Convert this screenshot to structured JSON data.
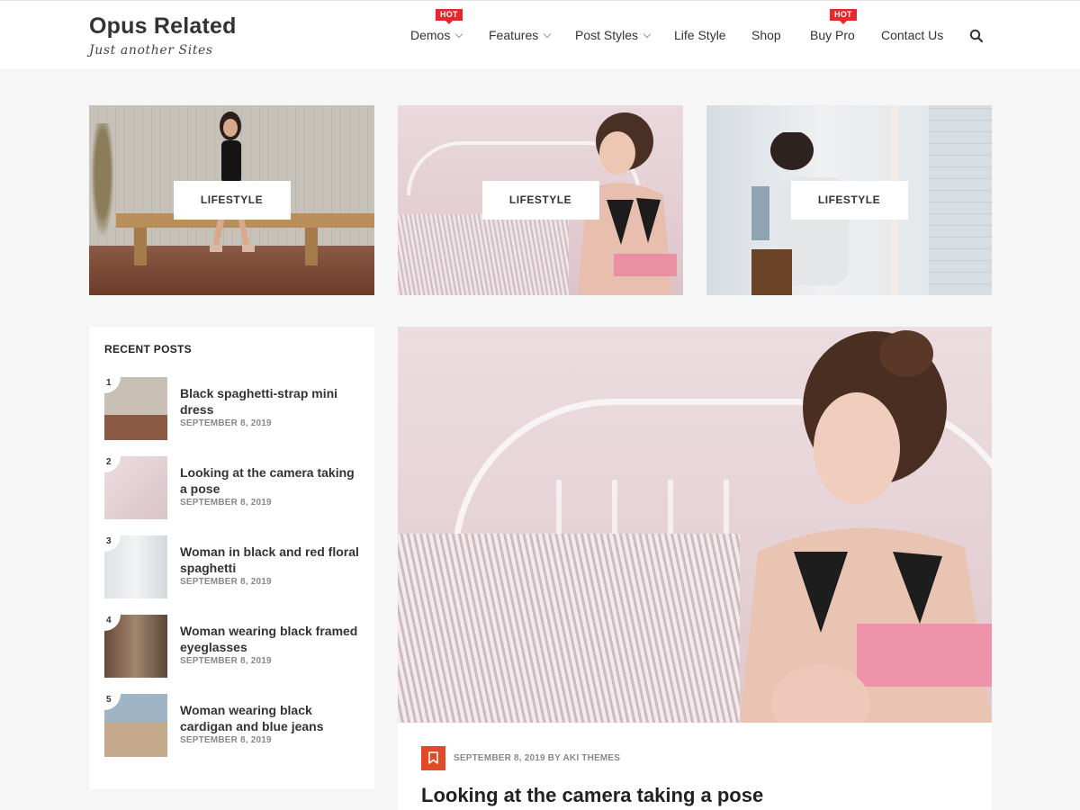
{
  "site": {
    "title": "Opus Related",
    "tagline": "Just another Sites"
  },
  "nav": {
    "items": [
      {
        "label": "Demos",
        "dropdown": true,
        "badge": "HOT"
      },
      {
        "label": "Features",
        "dropdown": true
      },
      {
        "label": "Post Styles",
        "dropdown": true
      },
      {
        "label": "Life Style"
      },
      {
        "label": "Shop"
      },
      {
        "label": "Buy Pro",
        "badge": "HOT"
      },
      {
        "label": "Contact Us"
      }
    ],
    "search_icon": "search-icon"
  },
  "featured": [
    {
      "category": "LIFESTYLE"
    },
    {
      "category": "LIFESTYLE"
    },
    {
      "category": "LIFESTYLE"
    }
  ],
  "recent_posts": {
    "heading": "RECENT POSTS",
    "items": [
      {
        "num": "1",
        "title": "Black spaghetti-strap mini dress",
        "date": "SEPTEMBER 8, 2019"
      },
      {
        "num": "2",
        "title": "Looking at the camera taking a pose",
        "date": "SEPTEMBER 8, 2019"
      },
      {
        "num": "3",
        "title": "Woman in black and red floral spaghetti",
        "date": "SEPTEMBER 8, 2019"
      },
      {
        "num": "4",
        "title": "Woman wearing black framed eyeglasses",
        "date": "SEPTEMBER 8, 2019"
      },
      {
        "num": "5",
        "title": "Woman wearing black cardigan and blue jeans",
        "date": "SEPTEMBER 8, 2019"
      }
    ]
  },
  "main_post": {
    "date": "SEPTEMBER 8, 2019",
    "by": "BY",
    "author": "AKI THEMES",
    "title": "Looking at the camera taking a pose",
    "icon": "bookmark-icon"
  },
  "colors": {
    "accent": "#e24a26",
    "badge": "#e8262b",
    "background": "#f6f6f6"
  }
}
